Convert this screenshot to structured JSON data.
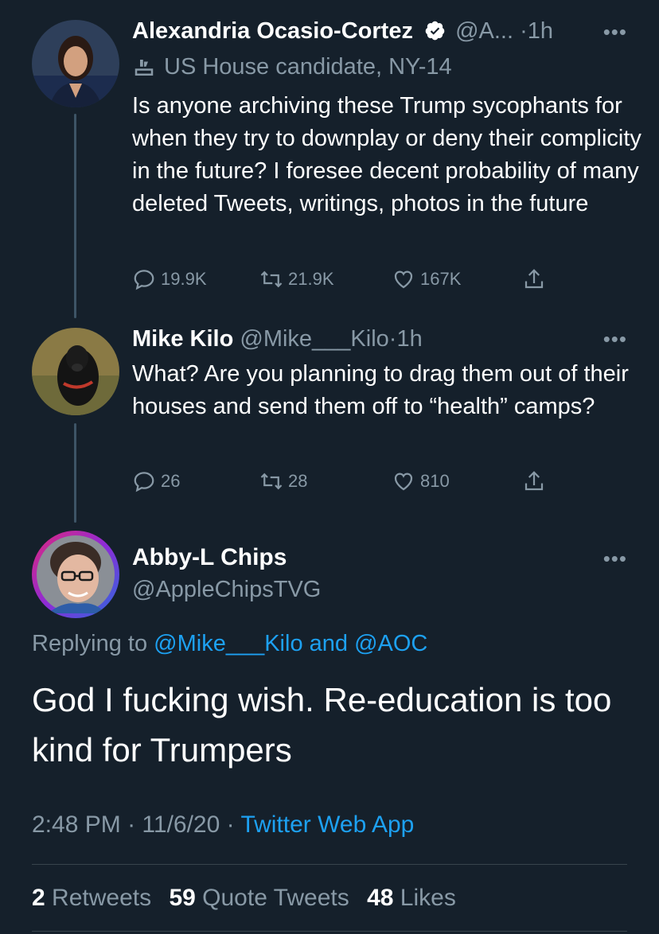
{
  "tweet1": {
    "name": "Alexandria Ocasio-Cortez",
    "handle": "@A...",
    "time": "1h",
    "label": "US House candidate, NY-14",
    "text": "Is anyone archiving these Trump sycophants for when they try to downplay or deny their complicity in the future? I foresee decent probability of many deleted Tweets, writings, photos in the future",
    "replies": "19.9K",
    "retweets": "21.9K",
    "likes": "167K"
  },
  "tweet2": {
    "name": "Mike Kilo",
    "handle": "@Mike___Kilo",
    "time": "1h",
    "text": "What? Are you planning to drag them out of their houses and send them off to “health” camps?",
    "replies": "26",
    "retweets": "28",
    "likes": "810"
  },
  "main": {
    "name": "Abby-L Chips",
    "handle": "@AppleChipsTVG",
    "replying_prefix": "Replying to",
    "replying_user1": "@Mike___Kilo",
    "replying_and": "and",
    "replying_user2": "@AOC",
    "text": "God I fucking wish. Re-education is too kind for Trumpers",
    "time": "2:48 PM",
    "date": "11/6/20",
    "source": "Twitter Web App",
    "retweets_count": "2",
    "retweets_label": "Retweets",
    "quotes_count": "59",
    "quotes_label": "Quote Tweets",
    "likes_count": "48",
    "likes_label": "Likes"
  },
  "separator": "·",
  "colors": {
    "background": "#15202b",
    "text": "#ffffff",
    "muted": "#8899a6",
    "link": "#1da1f2",
    "divider": "#38444d"
  },
  "icons": [
    "verified-icon",
    "more-icon",
    "government-label-icon",
    "reply-icon",
    "retweet-icon",
    "like-icon",
    "share-icon"
  ]
}
